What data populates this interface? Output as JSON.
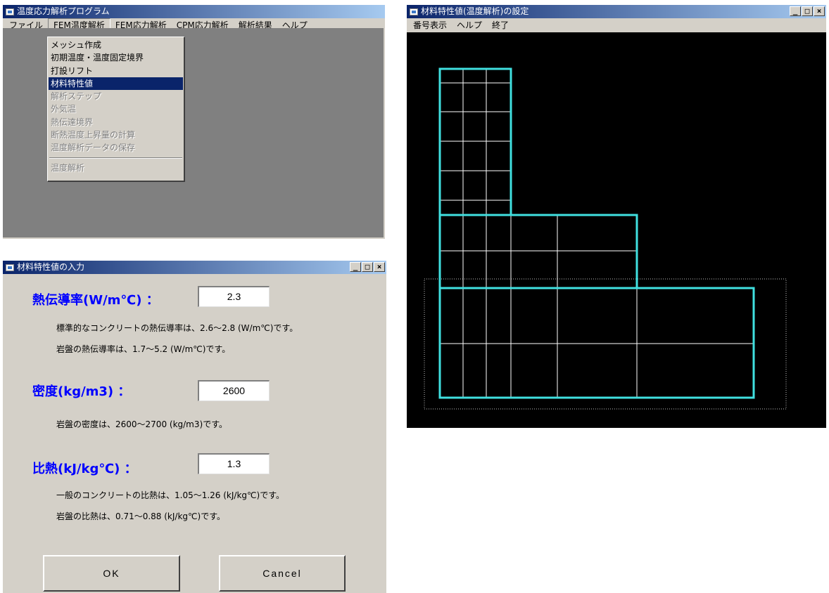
{
  "main_window": {
    "title": "温度応力解析プログラム",
    "menu": [
      "ファイル",
      "FEM温度解析",
      "FEM応力解析",
      "CPM応力解析",
      "解析結果",
      "ヘルプ"
    ],
    "dropdown": {
      "items": [
        "メッシュ作成",
        "初期温度・温度固定境界",
        "打設リフト",
        "材料特性値",
        "解析ステップ",
        "外気温",
        "熱伝達境界",
        "断熱温度上昇量の計算",
        "温度解析データの保存"
      ],
      "last_item": "温度解析",
      "selected": "材料特性値",
      "disabled": [
        "解析ステップ",
        "外気温",
        "熱伝達境界",
        "断熱温度上昇量の計算",
        "温度解析データの保存",
        "温度解析"
      ]
    }
  },
  "input_window": {
    "title": "材料特性値の入力",
    "conductivity": {
      "label": "熱伝導率(W/m℃) ：",
      "value": "2.3",
      "note1": "標準的なコンクリートの熱伝導率は、2.6～2.8 (W/m℃)です。",
      "note2": "岩盤の熱伝導率は、1.7～5.2 (W/m℃)です。"
    },
    "density": {
      "label": "密度(kg/m3) ：",
      "value": "2600",
      "note1": "岩盤の密度は、2600～2700 (kg/m3)です。"
    },
    "specific_heat": {
      "label": "比熱(kJ/kg℃) ：",
      "value": "1.3",
      "note1": "一般のコンクリートの比熱は、1.05～1.26 (kJ/kg℃)です。",
      "note2": "岩盤の比熱は、0.71～0.88 (kJ/kg℃)です。"
    },
    "ok_label": "OK",
    "cancel_label": "Cancel"
  },
  "mesh_window": {
    "title": "材料特性値(温度解析)の設定",
    "menu": [
      "番号表示",
      "ヘルプ",
      "終了"
    ]
  },
  "window_buttons": {
    "minimize": "_",
    "maximize": "□",
    "close": "×"
  },
  "colors": {
    "titlebar_start": "#0a246a",
    "titlebar_end": "#a6caf0",
    "window_face": "#d4d0c8",
    "heading_blue": "#0000ff",
    "mesh_outline": "#40e0e0",
    "canvas": "#000000"
  }
}
